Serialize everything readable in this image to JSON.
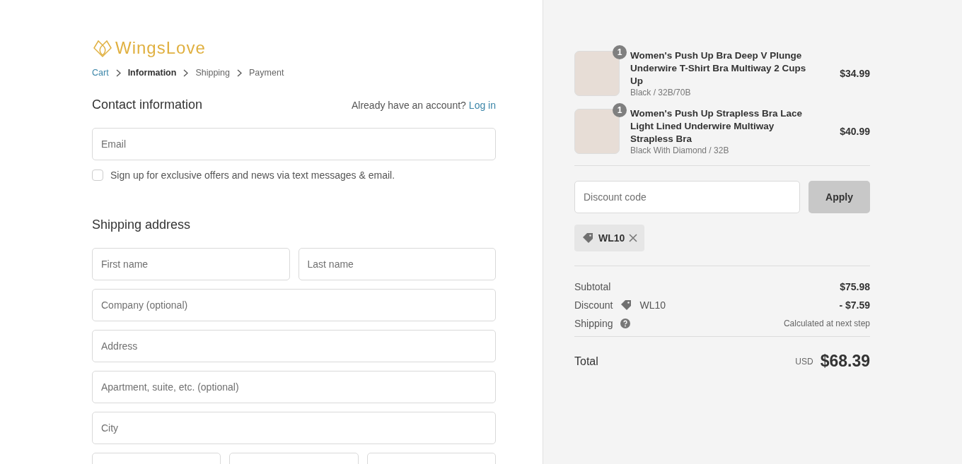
{
  "brand": {
    "name": "WingsLove"
  },
  "breadcrumbs": [
    {
      "label": "Cart",
      "kind": "link",
      "selected": false
    },
    {
      "label": "Information",
      "kind": "step",
      "selected": true
    },
    {
      "label": "Shipping",
      "kind": "step",
      "selected": false
    },
    {
      "label": "Payment",
      "kind": "step",
      "selected": false
    }
  ],
  "contact": {
    "title": "Contact information",
    "account_prompt": "Already have an account?",
    "login_link": "Log in",
    "email": {
      "placeholder": "Email"
    },
    "signup": {
      "label": "Sign up for exclusive offers and news via text messages & email.",
      "checked": false
    }
  },
  "shipping_address": {
    "title": "Shipping address",
    "rows": [
      [
        {
          "placeholder": "First name"
        },
        {
          "placeholder": "Last name"
        }
      ],
      [
        {
          "placeholder": "Company (optional)"
        }
      ],
      [
        {
          "placeholder": "Address"
        }
      ],
      [
        {
          "placeholder": "Apartment, suite, etc. (optional)"
        }
      ],
      [
        {
          "placeholder": "City"
        }
      ],
      [
        {
          "kind": "field"
        },
        {
          "kind": "field"
        },
        {
          "kind": "field"
        }
      ]
    ]
  },
  "order": {
    "items": [
      {
        "name": "Women's Push Up Bra Deep V Plunge Underwire T-Shirt Bra Multiway 2 Cups Up",
        "variant": "Black / 32B/70B",
        "quantity": "1",
        "price": "$34.99"
      },
      {
        "name": "Women's Push Up Strapless Bra Lace Light Lined Underwire Multiway Strapless Bra",
        "variant": "Black With Diamond / 32B",
        "quantity": "1",
        "price": "$40.99"
      }
    ],
    "discount_field": {
      "placeholder": "Discount code"
    },
    "apply_button": "Apply",
    "applied_code": "WL10",
    "subtotal": {
      "label": "Subtotal",
      "value": "$75.98"
    },
    "discount": {
      "label": "Discount",
      "code": "WL10",
      "value": "- $7.59"
    },
    "shipping": {
      "label": "Shipping",
      "value": "Calculated at next step"
    },
    "total": {
      "label": "Total",
      "currency": "USD",
      "value": "$68.39"
    }
  }
}
